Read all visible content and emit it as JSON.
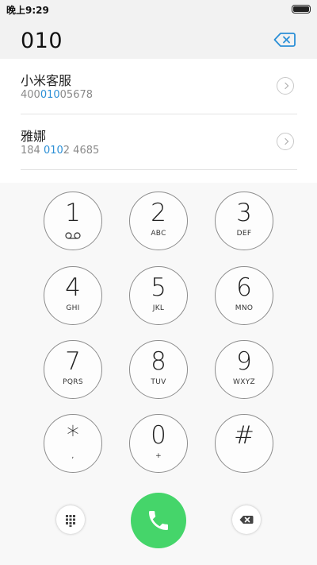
{
  "status_bar": {
    "time": "晚上9:29"
  },
  "dialer": {
    "input_value": "010"
  },
  "suggestions": [
    {
      "name": "小米客服",
      "number_before": "400",
      "number_match": "010",
      "number_after": "05678"
    },
    {
      "name": "雅娜",
      "number_before": "184 ",
      "number_match": "010",
      "number_after": "2 4685"
    }
  ],
  "keypad": {
    "keys": [
      {
        "digit": "1",
        "letters": ""
      },
      {
        "digit": "2",
        "letters": "ABC"
      },
      {
        "digit": "3",
        "letters": "DEF"
      },
      {
        "digit": "4",
        "letters": "GHI"
      },
      {
        "digit": "5",
        "letters": "JKL"
      },
      {
        "digit": "6",
        "letters": "MNO"
      },
      {
        "digit": "7",
        "letters": "PQRS"
      },
      {
        "digit": "8",
        "letters": "TUV"
      },
      {
        "digit": "9",
        "letters": "WXYZ"
      },
      {
        "digit": "*",
        "letters": ","
      },
      {
        "digit": "0",
        "letters": "+"
      },
      {
        "digit": "#",
        "letters": ""
      }
    ]
  },
  "icons": {
    "voicemail": "voicemail-icon",
    "backspace": "backspace-icon",
    "dialpad": "dialpad-icon",
    "call": "phone-icon",
    "arrow": "chevron-right-icon"
  },
  "colors": {
    "accent": "#2b8fd6",
    "call_green": "#45d56a"
  }
}
